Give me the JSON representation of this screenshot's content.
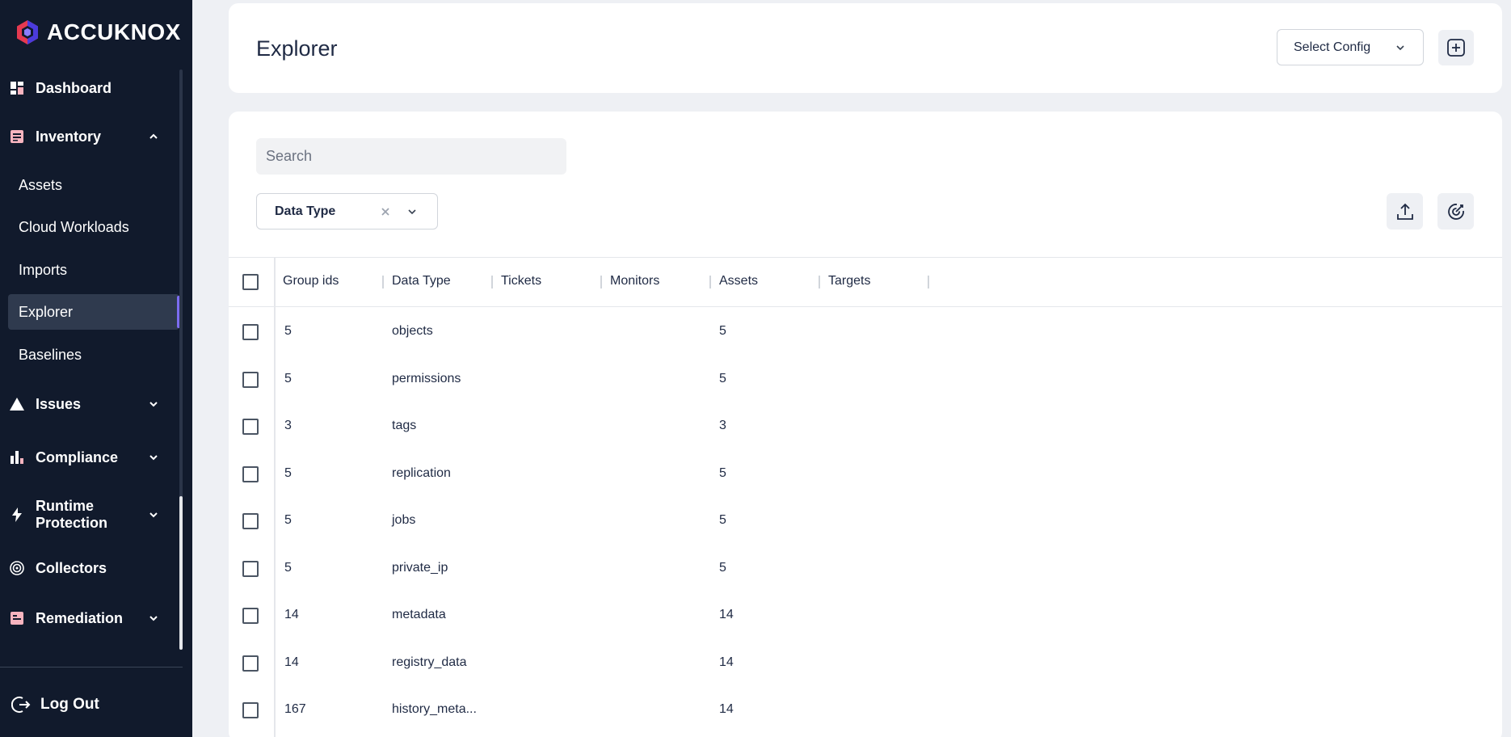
{
  "app": {
    "brand": "ACCUKNOX"
  },
  "sidebar": {
    "items": [
      {
        "label": "Dashboard",
        "icon": "dashboard-icon"
      },
      {
        "label": "Inventory",
        "icon": "inventory-icon",
        "expanded": true,
        "children": [
          "Assets",
          "Cloud Workloads",
          "Imports",
          "Explorer",
          "Baselines"
        ],
        "active_child": "Explorer"
      },
      {
        "label": "Issues",
        "icon": "warning-icon"
      },
      {
        "label": "Compliance",
        "icon": "compliance-icon"
      },
      {
        "label": "Runtime Protection",
        "icon": "bolt-icon"
      },
      {
        "label": "Collectors",
        "icon": "collectors-icon"
      },
      {
        "label": "Remediation",
        "icon": "remediation-icon"
      }
    ],
    "logout_label": "Log Out"
  },
  "header": {
    "title": "Explorer",
    "select_config_label": "Select Config"
  },
  "toolbar": {
    "search_placeholder": "Search",
    "filter_label": "Data Type"
  },
  "table": {
    "columns": [
      "Group ids",
      "Data Type",
      "Tickets",
      "Monitors",
      "Assets",
      "Targets"
    ],
    "rows": [
      {
        "group_ids": "5",
        "data_type": "objects",
        "tickets": "",
        "monitors": "",
        "assets": "5",
        "targets": ""
      },
      {
        "group_ids": "5",
        "data_type": "permissions",
        "tickets": "",
        "monitors": "",
        "assets": "5",
        "targets": ""
      },
      {
        "group_ids": "3",
        "data_type": "tags",
        "tickets": "",
        "monitors": "",
        "assets": "3",
        "targets": ""
      },
      {
        "group_ids": "5",
        "data_type": "replication",
        "tickets": "",
        "monitors": "",
        "assets": "5",
        "targets": ""
      },
      {
        "group_ids": "5",
        "data_type": "jobs",
        "tickets": "",
        "monitors": "",
        "assets": "5",
        "targets": ""
      },
      {
        "group_ids": "5",
        "data_type": "private_ip",
        "tickets": "",
        "monitors": "",
        "assets": "5",
        "targets": ""
      },
      {
        "group_ids": "14",
        "data_type": "metadata",
        "tickets": "",
        "monitors": "",
        "assets": "14",
        "targets": ""
      },
      {
        "group_ids": "14",
        "data_type": "registry_data",
        "tickets": "",
        "monitors": "",
        "assets": "14",
        "targets": ""
      },
      {
        "group_ids": "167",
        "data_type": "history_meta...",
        "tickets": "",
        "monitors": "",
        "assets": "14",
        "targets": ""
      }
    ]
  },
  "colors": {
    "sidebar_bg": "#111a2c",
    "active_accent": "#7c6cf0",
    "page_bg": "#eef0f4"
  }
}
